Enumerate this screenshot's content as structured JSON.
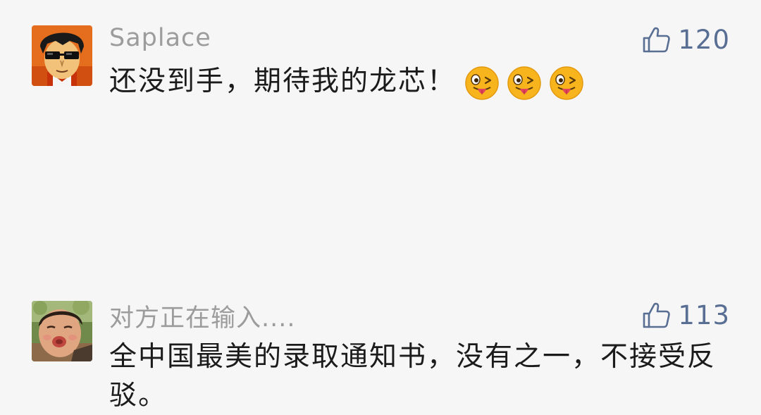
{
  "comments": [
    {
      "username": "Saplace",
      "likes": "120",
      "text": "还没到手，期待我的龙芯！",
      "emojis": [
        "tongue-wink-emoji",
        "tongue-wink-emoji",
        "tongue-wink-emoji"
      ],
      "avatar": "cartoon-man-sunglasses-avatar"
    },
    {
      "username": "对方正在输入....",
      "likes": "113",
      "text": "全中国最美的录取通知书，没有之一，不接受反驳。",
      "avatar": "child-photo-avatar"
    }
  ],
  "icons": {
    "like": "thumbs-up-outline-icon"
  },
  "colors": {
    "username": "#9c9c9c",
    "like": "#596e93",
    "text": "#1b1b1b",
    "background": "#f6f6f6"
  }
}
